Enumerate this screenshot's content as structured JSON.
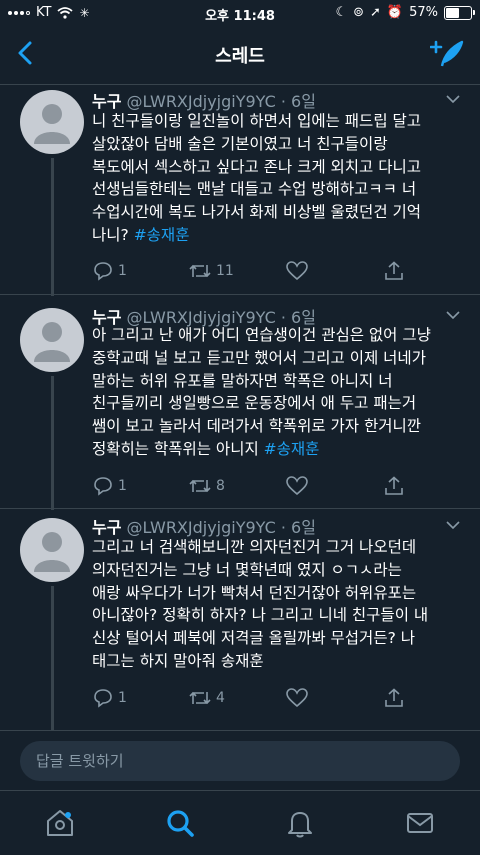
{
  "status": {
    "carrier": "KT",
    "time": "오후 11:48",
    "battery": "57%",
    "battery_level": 0.57
  },
  "nav": {
    "title": "스레드"
  },
  "tweets": [
    {
      "name": "누구",
      "handle": "@LWRXJdjyjgiY9YC",
      "dot": "·",
      "time": "6일",
      "text": "니 친구들이랑 일진놀이 하면서 입에는 패드립 달고\n살았잖아 담배 술은 기본이였고 너 친구들이랑\n복도에서 섹스하고 싶다고 존나 크게 외치고 다니고\n선생님들한테는 맨날 대들고 수업 방해하고ㅋㅋ  너\n수업시간에 복도 나가서 화제 비상벨 울렸던건 기억\n나니?",
      "hashtag": "#송재훈",
      "replies": "1",
      "retweets": "11",
      "likes": ""
    },
    {
      "name": "누구",
      "handle": "@LWRXJdjyjgiY9YC",
      "dot": "·",
      "time": "6일",
      "text": "아 그리고 난 애가 어디 연습생이건 관심은 없어 그냥\n중학교때 널 보고 듣고만 했어서 그리고 이제 너네가\n말하는 허위 유포를 말하자면 학폭은 아니지 너\n친구들끼리 생일빵으로 운동장에서 애 두고 패는거\n쌤이 보고 놀라서 데려가서 학폭위로 가자 한거니깐\n정확히는 학폭위는 아니지",
      "hashtag": "#송재훈",
      "replies": "1",
      "retweets": "8",
      "likes": ""
    },
    {
      "name": "누구",
      "handle": "@LWRXJdjyjgiY9YC",
      "dot": "·",
      "time": "6일",
      "text": "그리고 너 검색해보니깐 의자던진거 그거 나오던데\n의자던진거는 그냥 너 몇학년때 였지 ㅇㄱㅅ라는\n애랑 싸우다가 너가 빡쳐서 던진거잖아 허위유포는\n아니잖아? 정확히 하자? 나 그리고 니네 친구들이 내\n신상 털어서 페북에 저격글 올릴까봐 무섭거든? 나\n태그는 하지 말아줘 송재훈",
      "hashtag": "",
      "replies": "1",
      "retweets": "4",
      "likes": ""
    }
  ],
  "reply": {
    "placeholder": "답글 트윗하기"
  },
  "colors": {
    "background": "#15202b",
    "accent": "#1da1f2",
    "secondary_text": "#8899a6",
    "divider": "#38444d"
  },
  "icons": [
    "back-arrow-icon",
    "compose-icon",
    "chevron-down-icon",
    "reply-icon",
    "retweet-icon",
    "like-icon",
    "share-icon",
    "home-icon",
    "search-icon",
    "notifications-icon",
    "messages-icon"
  ]
}
